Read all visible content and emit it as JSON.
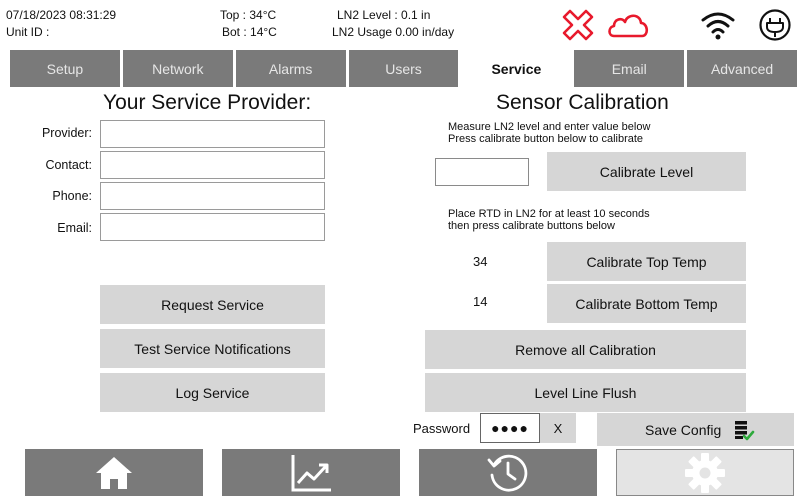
{
  "header": {
    "datetime": "07/18/2023 08:31:29",
    "unit_id": "Unit ID :",
    "top_temp": "Top : 34°C",
    "bot_temp": "Bot : 14°C",
    "ln2_level": "LN2 Level : 0.1 in",
    "ln2_usage": "LN2 Usage  0.00 in/day",
    "icons": [
      "error-x-icon",
      "cloud-icon",
      "wifi-icon",
      "power-plug-icon"
    ],
    "colors": {
      "alert": "#e8192c"
    }
  },
  "tabs": [
    {
      "label": "Setup",
      "active": false
    },
    {
      "label": "Network",
      "active": false
    },
    {
      "label": "Alarms",
      "active": false
    },
    {
      "label": "Users",
      "active": false
    },
    {
      "label": "Service",
      "active": true
    },
    {
      "label": "Email",
      "active": false
    },
    {
      "label": "Advanced",
      "active": false
    }
  ],
  "provider": {
    "title": "Your Service Provider:",
    "fields": [
      {
        "label": "Provider:",
        "value": ""
      },
      {
        "label": "Contact:",
        "value": ""
      },
      {
        "label": "Phone:",
        "value": ""
      },
      {
        "label": "Email:",
        "value": ""
      }
    ],
    "request_label": "Request Service",
    "test_label": "Test Service Notifications",
    "log_label": "Log Service"
  },
  "calibration": {
    "title": "Sensor Calibration",
    "note1_line1": "Measure LN2 level and enter value below",
    "note1_line2": "Press calibrate button below to calibrate",
    "level_value": "",
    "calibrate_level_label": "Calibrate Level",
    "note2_line1": "Place RTD in LN2 for at least 10 seconds",
    "note2_line2": "then press calibrate buttons below",
    "top_value": "34",
    "calibrate_top_label": "Calibrate Top Temp",
    "bottom_value": "14",
    "calibrate_bottom_label": "Calibrate Bottom Temp",
    "remove_label": "Remove all Calibration",
    "flush_label": "Level Line Flush"
  },
  "footer": {
    "password_label": "Password",
    "password_value": "●●●●",
    "clear_label": "X",
    "save_config_label": "Save Config",
    "save_icon": "database-check-icon"
  },
  "nav": [
    "home-icon",
    "chart-trend-icon",
    "history-icon",
    "gear-icon"
  ]
}
